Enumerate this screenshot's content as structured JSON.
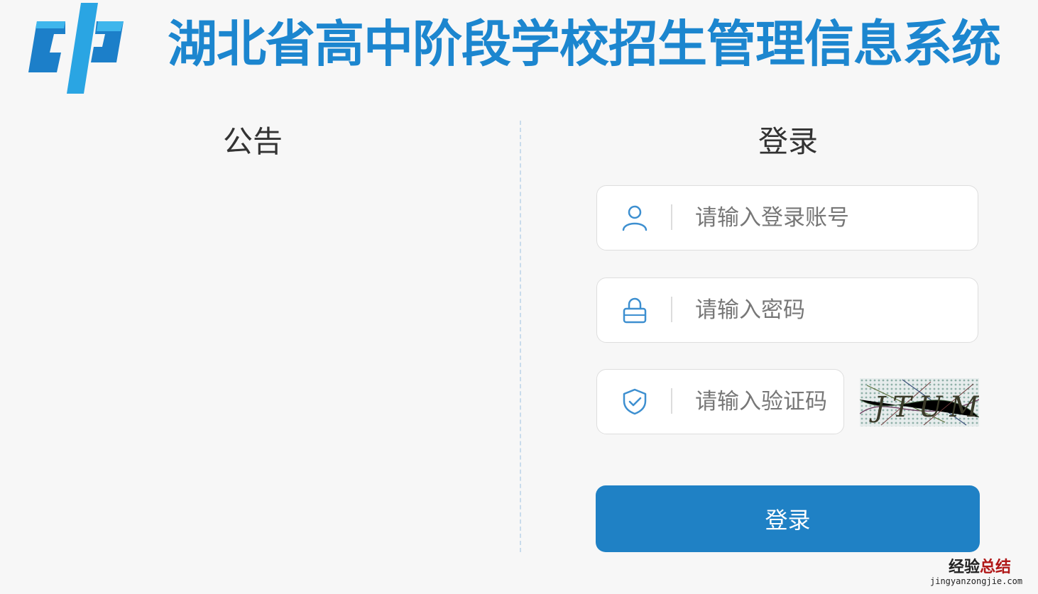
{
  "header": {
    "title": "湖北省高中阶段学校招生管理信息系统",
    "logo_icon": "zhong-logo-icon"
  },
  "notice": {
    "title": "公告"
  },
  "login": {
    "title": "登录",
    "username": {
      "placeholder": "请输入登录账号",
      "value": "",
      "icon": "user-icon"
    },
    "password": {
      "placeholder": "请输入密码",
      "value": "",
      "icon": "lock-icon"
    },
    "captcha": {
      "placeholder": "请输入验证码",
      "value": "",
      "icon": "shield-check-icon",
      "image_text": "JTUM"
    },
    "submit_label": "登录"
  },
  "watermark": {
    "text_a": "经验",
    "text_b": "总结",
    "url": "jingyanzongjie.com"
  },
  "colors": {
    "brand": "#1c86cf",
    "button": "#1f81c5",
    "background": "#f7f7f7"
  }
}
